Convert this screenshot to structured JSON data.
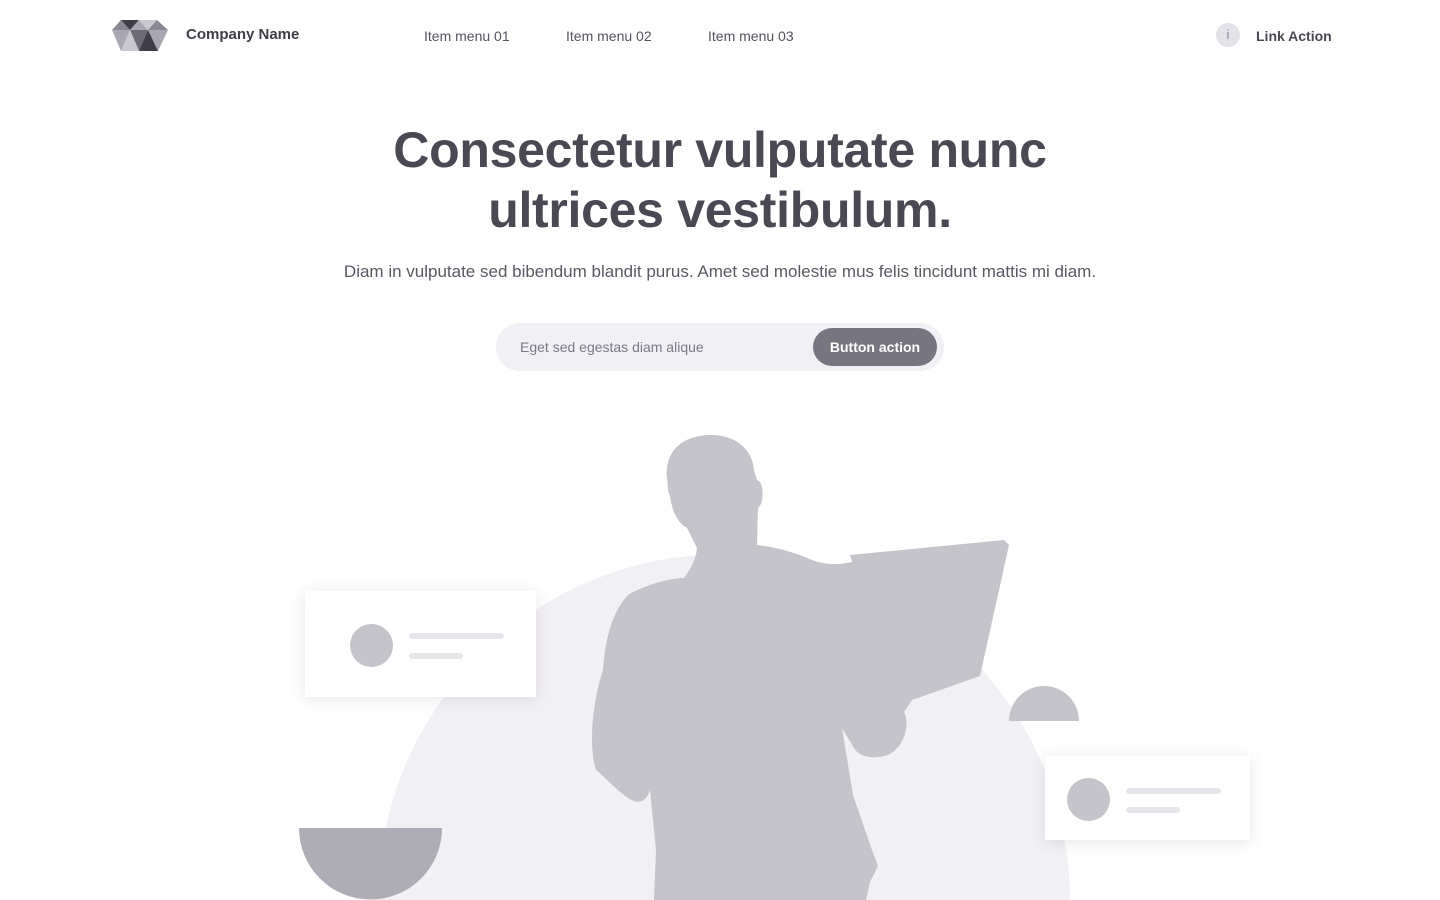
{
  "header": {
    "company_name": "Company Name",
    "nav": [
      "Item menu 01",
      "Item menu 02",
      "Item menu 03"
    ],
    "info_icon_glyph": "i",
    "link_action": "Link Action"
  },
  "hero": {
    "title_line_1": "Consectetur vulputate nunc",
    "title_line_2": "ultrices vestibulum.",
    "subtitle": "Diam in vulputate sed bibendum blandit purus. Amet sed molestie mus felis tincidunt mattis mi diam."
  },
  "search": {
    "placeholder": "Eget sed egestas diam alique",
    "value": "",
    "button_label": "Button action"
  },
  "icons": {
    "logo": "triangle-mosaic-logo-icon",
    "info": "info-icon"
  },
  "colors": {
    "text_dark": "#4a4853",
    "button": "#77757f",
    "illustration_backdrop": "#f1f0f4",
    "illustration_figure": "#c5c4cb",
    "illustration_accent": "#aeadb6"
  }
}
